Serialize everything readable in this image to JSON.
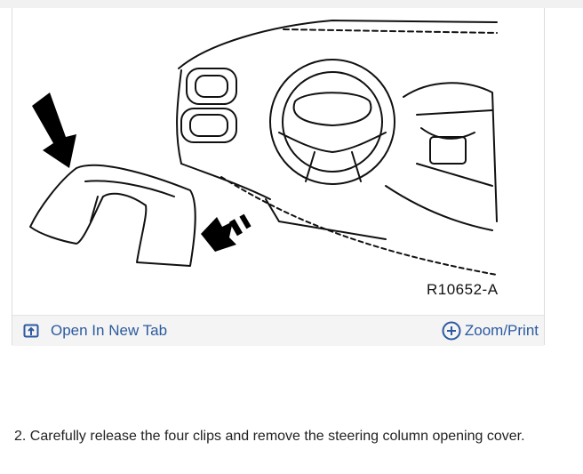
{
  "figure": {
    "code": "R10652-A"
  },
  "toolbar": {
    "open_tab_label": "Open In New Tab",
    "zoom_label": "Zoom/Print"
  },
  "step": {
    "text": "2. Carefully release the four clips and remove the steering column opening cover."
  },
  "icons": {
    "open_tab": "open-in-new-tab-icon",
    "zoom": "plus-circle-icon"
  },
  "colors": {
    "link": "#2c5aa0",
    "toolbar_bg": "#f4f4f4"
  }
}
